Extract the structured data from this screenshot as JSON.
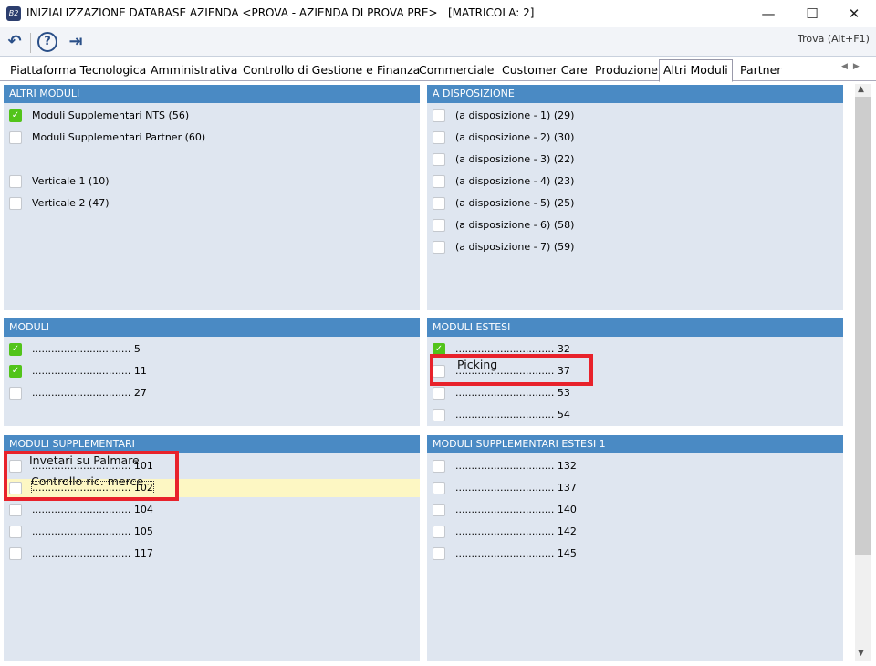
{
  "window": {
    "icon_text": "B2",
    "title": "INIZIALIZZAZIONE DATABASE AZIENDA <PROVA - AZIENDA DI PROVA PRE>   [MATRICOLA: 2]",
    "minimize": "—",
    "maximize": "☐",
    "close": "✕"
  },
  "toolbar": {
    "back_icon": "undo-arrow",
    "help_icon": "question-bubble",
    "exit_icon": "exit-door",
    "find_label": "Trova (Alt+F1)"
  },
  "tabs": [
    {
      "label": "Piattaforma Tecnologica"
    },
    {
      "label": "Amministrativa"
    },
    {
      "label": "Controllo di Gestione e Finanza"
    },
    {
      "label": "Commerciale"
    },
    {
      "label": "Customer Care"
    },
    {
      "label": "Produzione"
    },
    {
      "label": "Altri Moduli",
      "active": true
    },
    {
      "label": "Partner"
    }
  ],
  "panels": [
    {
      "title": "ALTRI MODULI",
      "items": [
        {
          "label": "Moduli Supplementari NTS (56)",
          "checked": true
        },
        {
          "label": "Moduli Supplementari Partner (60)",
          "checked": false
        },
        {
          "spacer": true
        },
        {
          "label": "Verticale 1 (10)",
          "checked": false
        },
        {
          "label": "Verticale 2 (47)",
          "checked": false
        }
      ]
    },
    {
      "title": "A DISPOSIZIONE",
      "items": [
        {
          "label": "(a disposizione - 1) (29)",
          "checked": false
        },
        {
          "label": "(a disposizione - 2) (30)",
          "checked": false
        },
        {
          "label": "(a disposizione - 3) (22)",
          "checked": false
        },
        {
          "label": "(a disposizione - 4) (23)",
          "checked": false
        },
        {
          "label": "(a disposizione - 5) (25)",
          "checked": false
        },
        {
          "label": "(a disposizione - 6) (58)",
          "checked": false
        },
        {
          "label": "(a disposizione - 7) (59)",
          "checked": false
        }
      ]
    },
    {
      "title": "MODULI",
      "items": [
        {
          "label": "............................... 5",
          "checked": true
        },
        {
          "label": "............................... 11",
          "checked": true
        },
        {
          "label": "............................... 27",
          "checked": false
        }
      ]
    },
    {
      "title": "MODULI ESTESI",
      "items": [
        {
          "label": "............................... 32",
          "checked": true
        },
        {
          "label": "............................... 37",
          "checked": false
        },
        {
          "label": "............................... 53",
          "checked": false
        },
        {
          "label": "............................... 54",
          "checked": false
        }
      ]
    },
    {
      "title": "MODULI SUPPLEMENTARI",
      "items": [
        {
          "label": "............................... 101",
          "checked": false
        },
        {
          "label": "............................... 102",
          "checked": false,
          "selected": true
        },
        {
          "label": "............................... 104",
          "checked": false
        },
        {
          "label": "............................... 105",
          "checked": false
        },
        {
          "label": "............................... 117",
          "checked": false
        }
      ]
    },
    {
      "title": "MODULI SUPPLEMENTARI ESTESI 1",
      "items": [
        {
          "label": "............................... 132",
          "checked": false
        },
        {
          "label": "............................... 137",
          "checked": false
        },
        {
          "label": "............................... 140",
          "checked": false
        },
        {
          "label": "............................... 142",
          "checked": false
        },
        {
          "label": "............................... 145",
          "checked": false
        }
      ]
    }
  ],
  "annotations": {
    "a101": "Invetari su Palmare",
    "a102": "Controllo ric. merce",
    "a37": "Picking"
  },
  "colors": {
    "header": "#4a8ac4",
    "panel": "#dfe6f0",
    "checked": "#52c41a",
    "highlight": "#fdf7c3",
    "annotation_box": "#e8222b"
  }
}
